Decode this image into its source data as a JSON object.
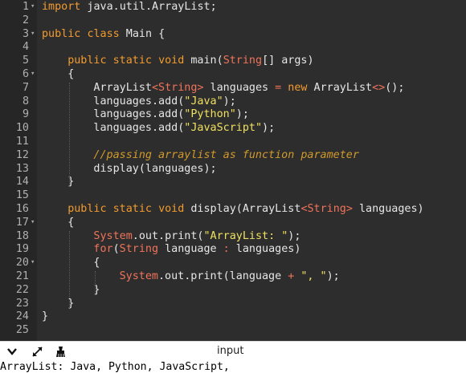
{
  "editor": {
    "lines": [
      {
        "n": "1",
        "fold": true,
        "indent": 0,
        "tokens": [
          [
            "kw",
            "import"
          ],
          [
            "tx",
            " java.util.ArrayList;"
          ]
        ]
      },
      {
        "n": "2",
        "fold": false,
        "indent": 0,
        "tokens": []
      },
      {
        "n": "3",
        "fold": true,
        "indent": 0,
        "tokens": [
          [
            "kw",
            "public"
          ],
          [
            "tx",
            " "
          ],
          [
            "kw",
            "class"
          ],
          [
            "tx",
            " Main {"
          ]
        ]
      },
      {
        "n": "4",
        "fold": false,
        "indent": 0,
        "tokens": []
      },
      {
        "n": "5",
        "fold": false,
        "indent": 4,
        "tokens": [
          [
            "kw",
            "public"
          ],
          [
            "tx",
            " "
          ],
          [
            "kw",
            "static"
          ],
          [
            "tx",
            " "
          ],
          [
            "kw",
            "void"
          ],
          [
            "tx",
            " main("
          ],
          [
            "ty",
            "String"
          ],
          [
            "tx",
            "[] args)"
          ]
        ]
      },
      {
        "n": "6",
        "fold": true,
        "indent": 4,
        "tokens": [
          [
            "tx",
            "{"
          ]
        ]
      },
      {
        "n": "7",
        "fold": false,
        "indent": 8,
        "tokens": [
          [
            "tx",
            "ArrayList"
          ],
          [
            "ty",
            "<String>"
          ],
          [
            "tx",
            " languages "
          ],
          [
            "op",
            "="
          ],
          [
            "tx",
            " "
          ],
          [
            "kw",
            "new"
          ],
          [
            "tx",
            " ArrayList"
          ],
          [
            "op",
            "<>"
          ],
          [
            "tx",
            "();"
          ]
        ]
      },
      {
        "n": "8",
        "fold": false,
        "indent": 8,
        "tokens": [
          [
            "tx",
            "languages.add("
          ],
          [
            "st",
            "\"Java\""
          ],
          [
            "tx",
            ");"
          ]
        ]
      },
      {
        "n": "9",
        "fold": false,
        "indent": 8,
        "tokens": [
          [
            "tx",
            "languages.add("
          ],
          [
            "st",
            "\"Python\""
          ],
          [
            "tx",
            ");"
          ]
        ]
      },
      {
        "n": "10",
        "fold": false,
        "indent": 8,
        "tokens": [
          [
            "tx",
            "languages.add("
          ],
          [
            "st",
            "\"JavaScript\""
          ],
          [
            "tx",
            ");"
          ]
        ]
      },
      {
        "n": "11",
        "fold": false,
        "indent": 0,
        "tokens": []
      },
      {
        "n": "12",
        "fold": false,
        "indent": 8,
        "tokens": [
          [
            "cm",
            "//passing arraylist as function parameter"
          ]
        ]
      },
      {
        "n": "13",
        "fold": false,
        "indent": 8,
        "tokens": [
          [
            "tx",
            "display(languages);"
          ]
        ]
      },
      {
        "n": "14",
        "fold": false,
        "indent": 4,
        "tokens": [
          [
            "tx",
            "}"
          ]
        ]
      },
      {
        "n": "15",
        "fold": false,
        "indent": 0,
        "tokens": []
      },
      {
        "n": "16",
        "fold": false,
        "indent": 4,
        "tokens": [
          [
            "kw",
            "public"
          ],
          [
            "tx",
            " "
          ],
          [
            "kw",
            "static"
          ],
          [
            "tx",
            " "
          ],
          [
            "kw",
            "void"
          ],
          [
            "tx",
            " display(ArrayList"
          ],
          [
            "ty",
            "<String>"
          ],
          [
            "tx",
            " languages)"
          ]
        ]
      },
      {
        "n": "17",
        "fold": true,
        "indent": 4,
        "tokens": [
          [
            "tx",
            "{"
          ]
        ]
      },
      {
        "n": "18",
        "fold": false,
        "indent": 8,
        "tokens": [
          [
            "ty",
            "System"
          ],
          [
            "tx",
            ".out.print("
          ],
          [
            "st",
            "\"ArrayList: \""
          ],
          [
            "tx",
            ");"
          ]
        ]
      },
      {
        "n": "19",
        "fold": false,
        "indent": 8,
        "tokens": [
          [
            "ty",
            "for"
          ],
          [
            "tx",
            "("
          ],
          [
            "ty",
            "String"
          ],
          [
            "tx",
            " language "
          ],
          [
            "op",
            ":"
          ],
          [
            "tx",
            " languages)"
          ]
        ]
      },
      {
        "n": "20",
        "fold": true,
        "indent": 8,
        "tokens": [
          [
            "tx",
            "{"
          ]
        ]
      },
      {
        "n": "21",
        "fold": false,
        "indent": 12,
        "tokens": [
          [
            "ty",
            "System"
          ],
          [
            "tx",
            ".out.print(language "
          ],
          [
            "op",
            "+"
          ],
          [
            "tx",
            " "
          ],
          [
            "st",
            "\", \""
          ],
          [
            "tx",
            ");"
          ]
        ]
      },
      {
        "n": "22",
        "fold": false,
        "indent": 8,
        "tokens": [
          [
            "tx",
            "}"
          ]
        ]
      },
      {
        "n": "23",
        "fold": false,
        "indent": 4,
        "tokens": [
          [
            "tx",
            "}"
          ]
        ]
      },
      {
        "n": "24",
        "fold": false,
        "indent": 0,
        "tokens": [
          [
            "tx",
            "}"
          ]
        ]
      },
      {
        "n": "25",
        "fold": false,
        "indent": 0,
        "tokens": []
      }
    ]
  },
  "toolbar": {
    "collapse_icon": "chevron-down-icon",
    "expand_icon": "expand-arrows-icon",
    "clear_icon": "clear-output-icon",
    "input_label": "input"
  },
  "output": {
    "text": "ArrayList: Java, Python, JavaScript, "
  },
  "colors": {
    "editor_bg": "#2d2d2d",
    "keyword": "#f29b2e",
    "type": "#f0735a",
    "string": "#efe05e",
    "comment": "#d29a2c"
  }
}
